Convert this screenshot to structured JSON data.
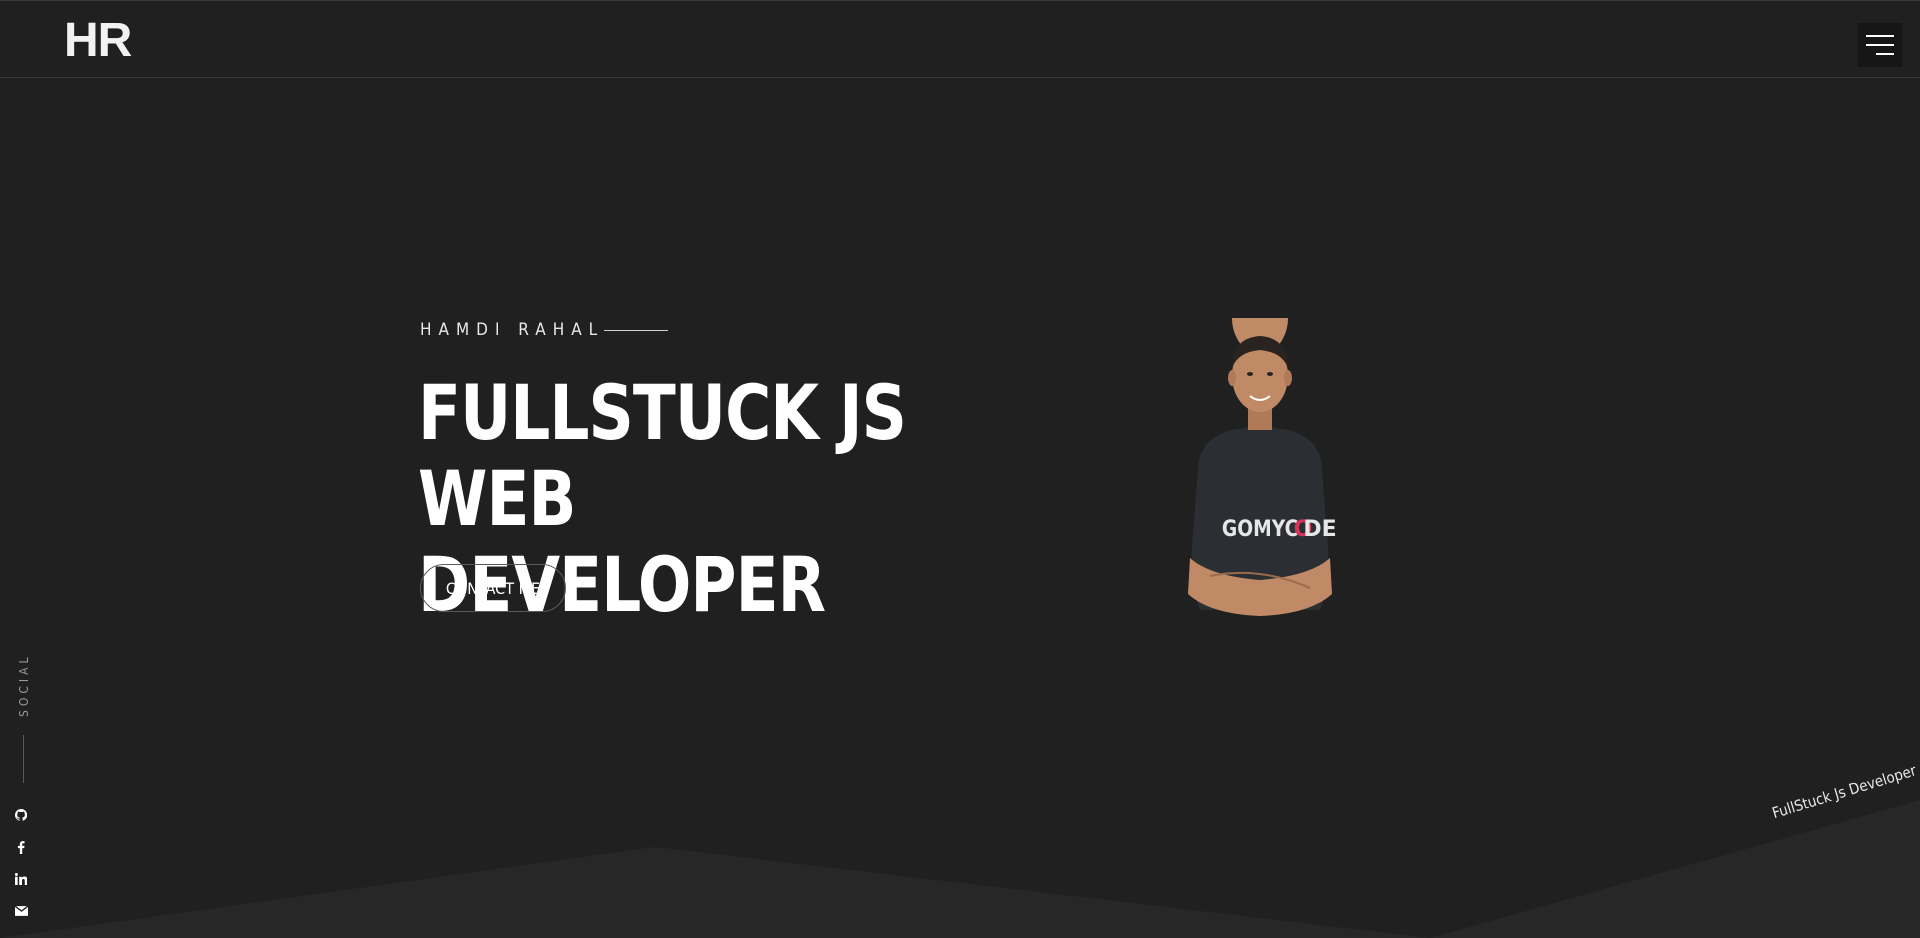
{
  "header": {
    "logo": "HR",
    "menu_icon": "hamburger-icon"
  },
  "hero": {
    "eyebrow": "HAMDI RAHAL",
    "headline_line1": "FULLSTUCK JS WEB",
    "headline_line2": "DEVELOPER",
    "contact_button": "CONTACT ME",
    "portrait_shirt_text": "GOMYCODE"
  },
  "social": {
    "label": "SOCIAL",
    "icons": [
      "github-icon",
      "facebook-icon",
      "linkedin-icon",
      "email-icon"
    ]
  },
  "tagline": "FullStuck Js Developer",
  "colors": {
    "background": "#202020",
    "bottom_shape": "#272727",
    "text": "#ffffff",
    "accent_red": "#d6335a"
  }
}
